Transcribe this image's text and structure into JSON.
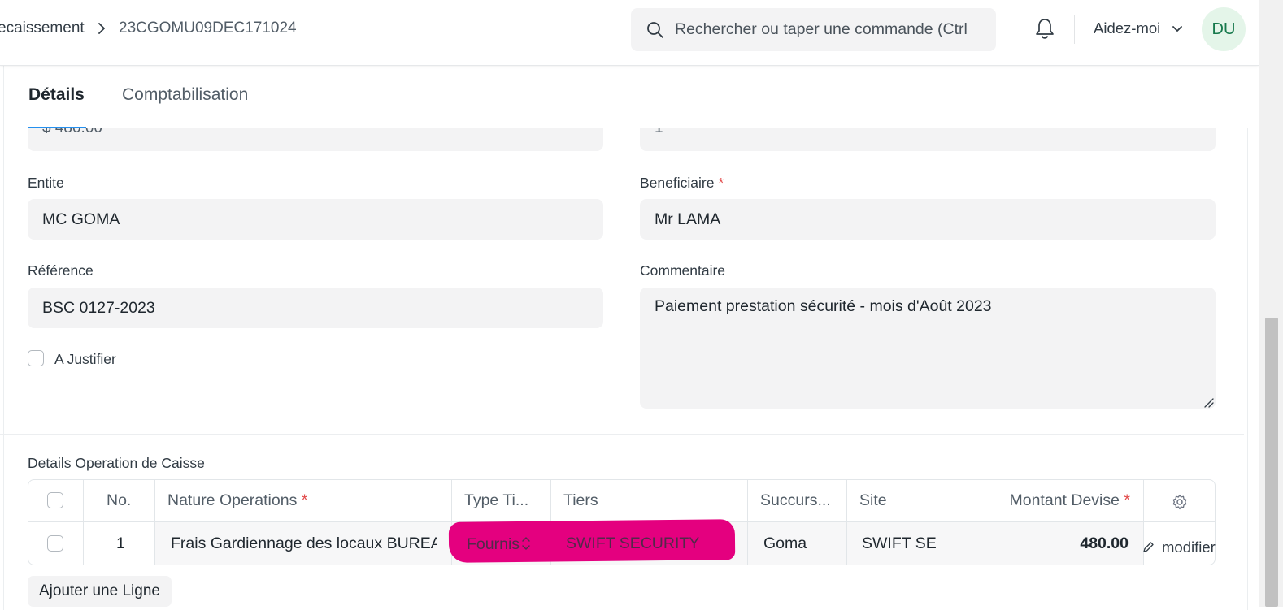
{
  "breadcrumb": {
    "parent": "ecaissement",
    "current": "23CGOMU09DEC171024"
  },
  "search": {
    "placeholder": "Rechercher ou taper une commande (Ctrl"
  },
  "help": {
    "label": "Aidez-moi"
  },
  "user": {
    "initials": "DU"
  },
  "tabs": [
    {
      "label": "Détails"
    },
    {
      "label": "Comptabilisation"
    }
  ],
  "form": {
    "partial_left_value": "$ 480.00",
    "partial_right_value": "1",
    "entite": {
      "label": "Entite",
      "value": "MC GOMA"
    },
    "beneficiaire": {
      "label": "Beneficiaire",
      "value": "Mr LAMA",
      "required_mark": "*"
    },
    "reference": {
      "label": "Référence",
      "value": "BSC 0127-2023"
    },
    "commentaire": {
      "label": "Commentaire",
      "value": "Paiement prestation sécurité - mois d'Août 2023"
    },
    "a_justifier": {
      "label": "A Justifier",
      "checked": false
    }
  },
  "table": {
    "title": "Details Operation de Caisse",
    "columns": {
      "no": "No.",
      "nature": "Nature Operations",
      "type_tiers": "Type Ti...",
      "tiers": "Tiers",
      "succursale": "Succurs...",
      "site": "Site",
      "montant": "Montant Devise",
      "required_mark": "*"
    },
    "rows": [
      {
        "no": "1",
        "nature": "Frais Gardiennage des locaux  BUREAU",
        "type_tiers": "Fournis",
        "tiers": "SWIFT SECURITY",
        "succursale": "Goma",
        "site": "SWIFT SECURITY",
        "montant": "480.00",
        "edit_label": "modifier"
      }
    ],
    "add_row_label": "Ajouter une Ligne"
  },
  "colors": {
    "accent": "#2490ef",
    "required": "#e24c4c",
    "redaction": "#e4007f",
    "avatar_bg": "#e4f5e9",
    "avatar_fg": "#16794c"
  }
}
